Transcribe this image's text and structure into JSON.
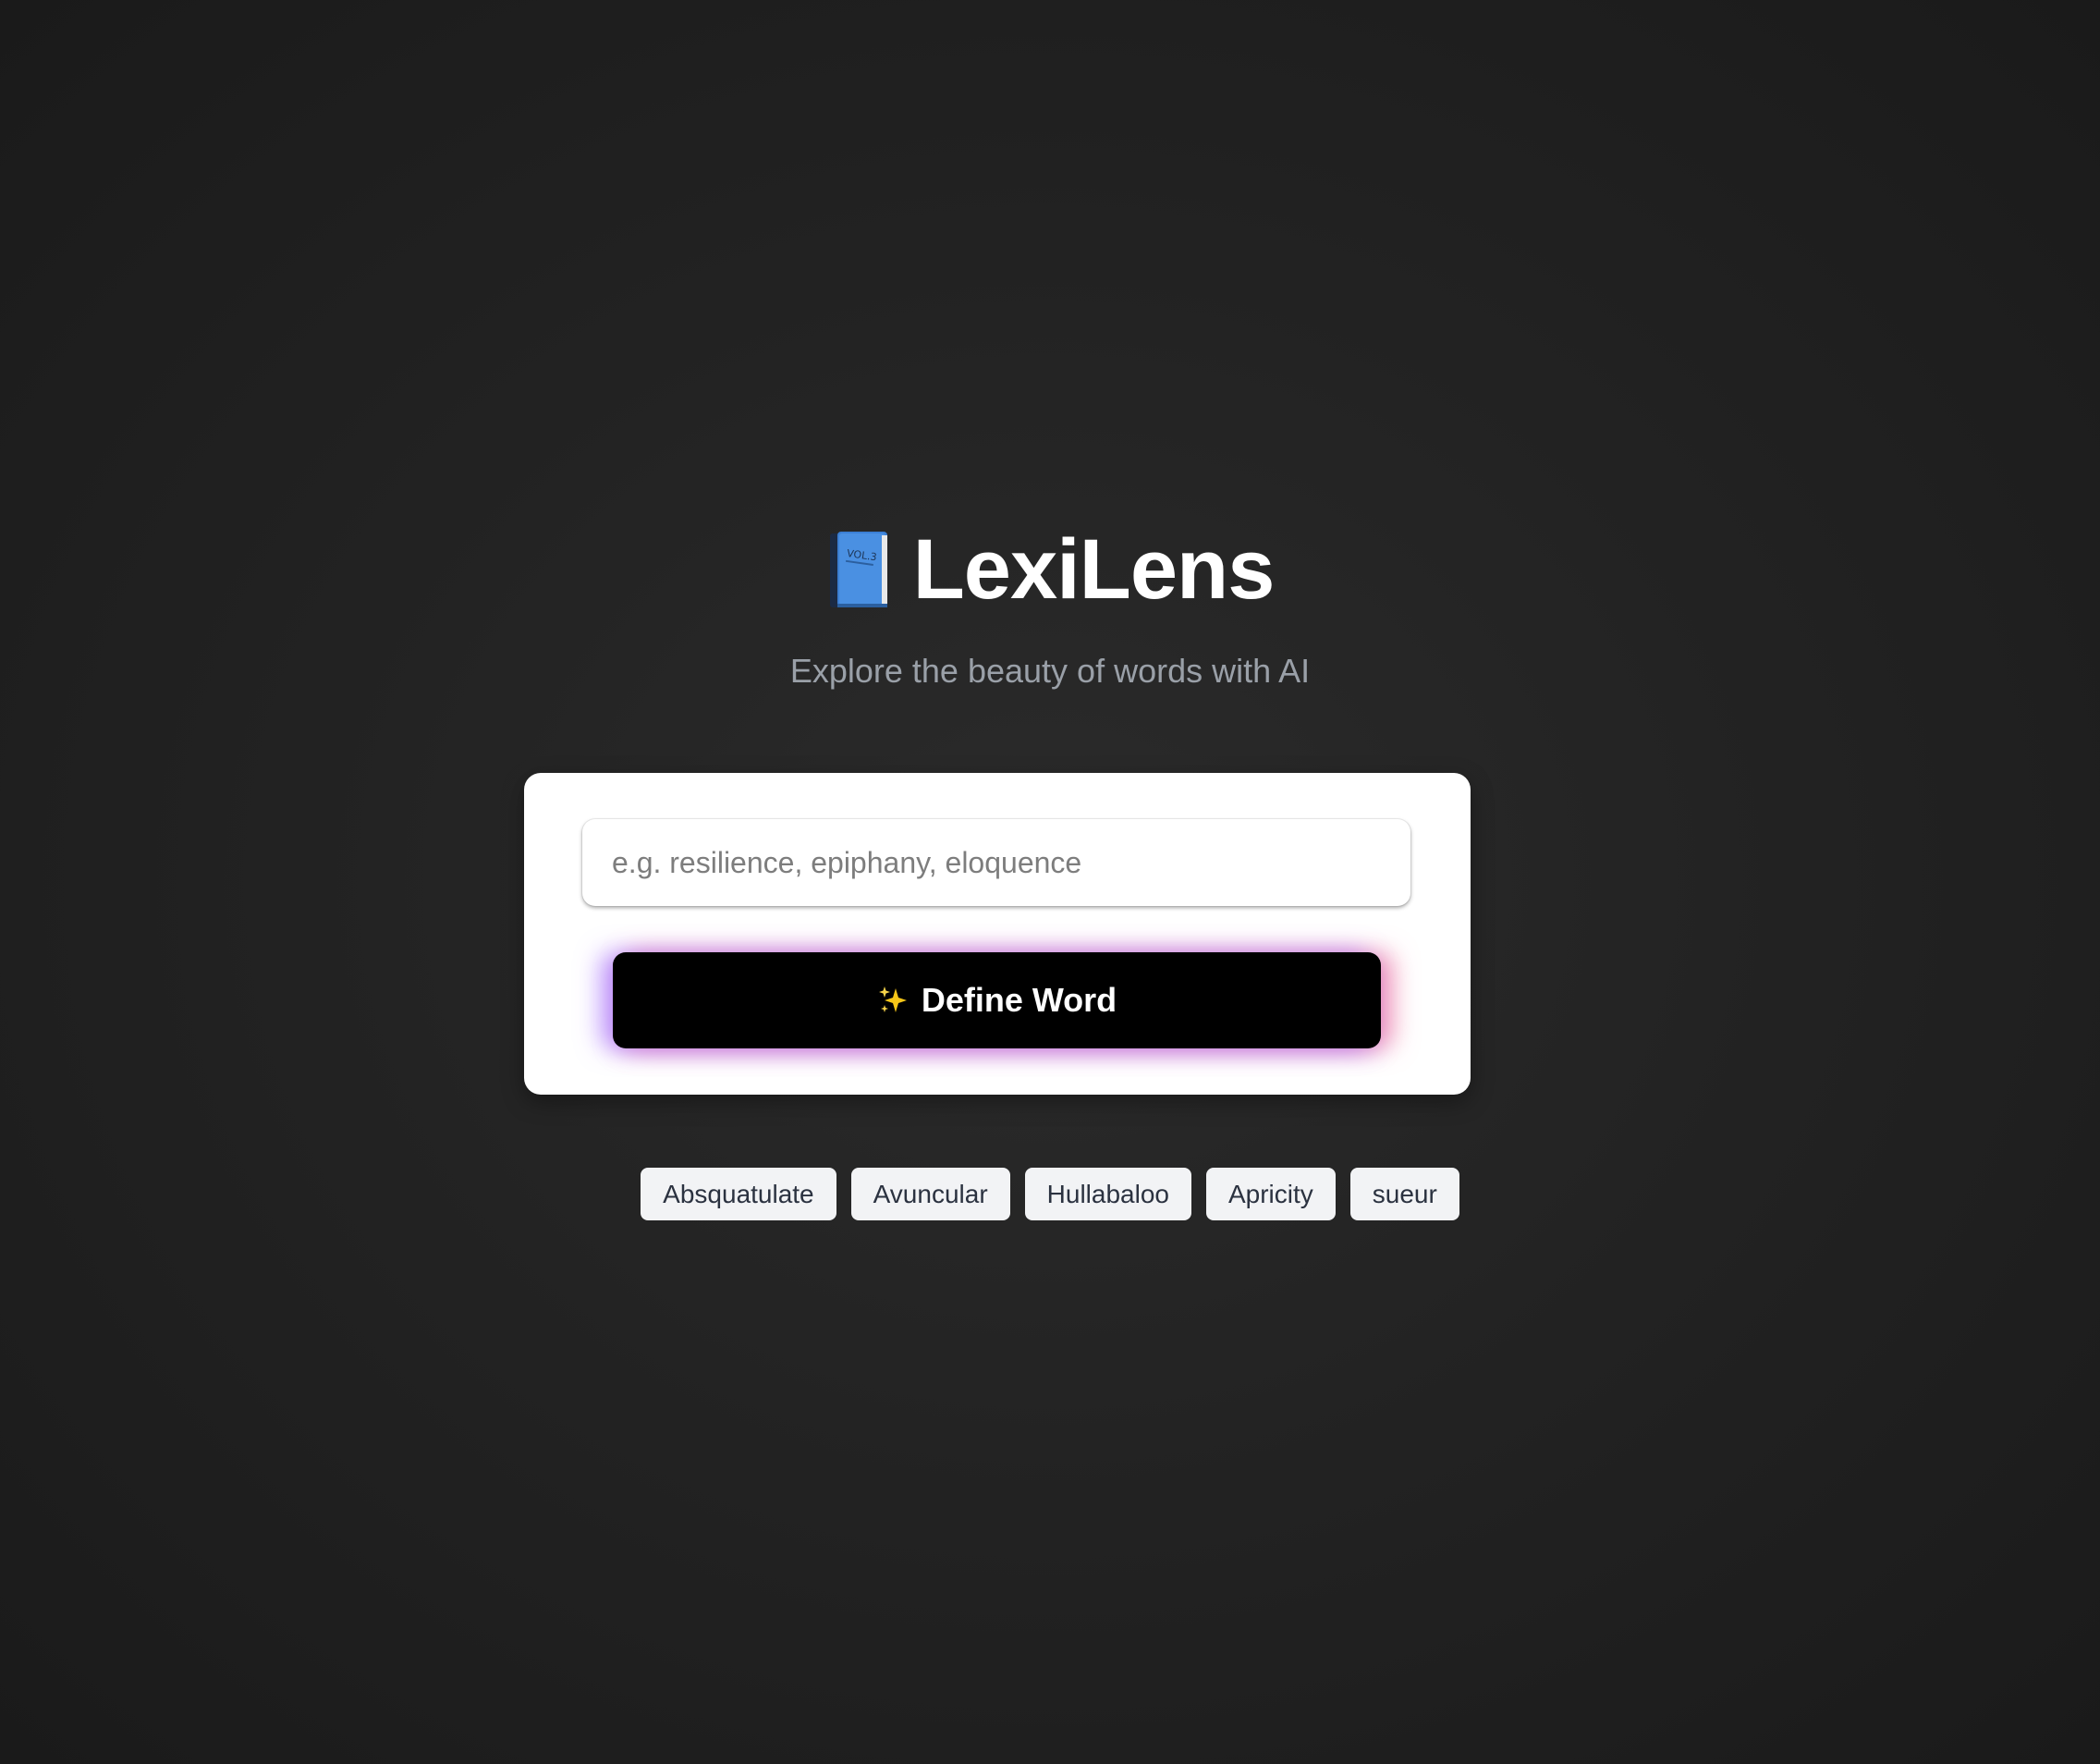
{
  "app": {
    "title": "LexiLens",
    "subtitle": "Explore the beauty of words with AI",
    "logo_icon": "blue-book-icon"
  },
  "search": {
    "placeholder": "e.g. resilience, epiphany, eloquence",
    "value": ""
  },
  "define_button": {
    "label": "Define Word",
    "icon": "sparkles-icon"
  },
  "suggestions": [
    {
      "label": "Absquatulate"
    },
    {
      "label": "Avuncular"
    },
    {
      "label": "Hullabaloo"
    },
    {
      "label": "Apricity"
    },
    {
      "label": "sueur"
    }
  ],
  "colors": {
    "background": "#232323",
    "card": "#ffffff",
    "button": "#000000",
    "glow_left": "#965aff",
    "glow_right": "#eb5a8c",
    "chip_bg": "#f2f3f5",
    "subtitle": "#9aa0a8"
  }
}
